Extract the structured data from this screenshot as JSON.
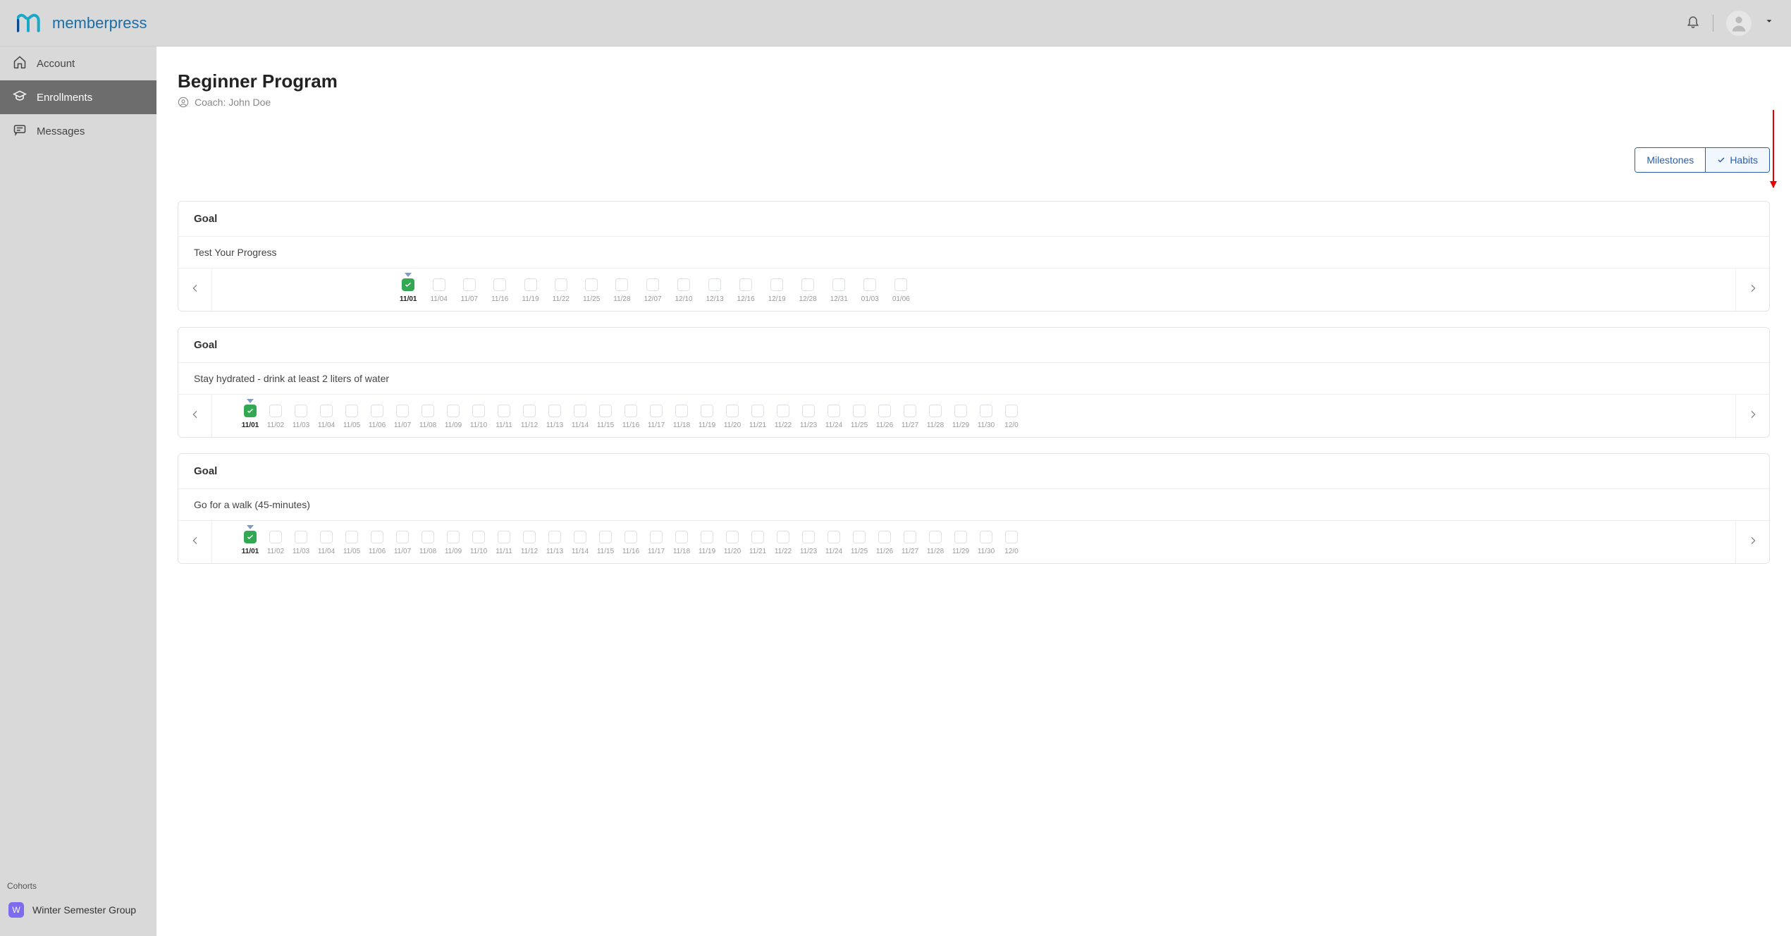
{
  "brand": "memberpress",
  "sidebar": {
    "items": [
      {
        "label": "Account",
        "active": false,
        "icon": "home-icon"
      },
      {
        "label": "Enrollments",
        "active": true,
        "icon": "mortarboard-icon"
      },
      {
        "label": "Messages",
        "active": false,
        "icon": "chat-icon"
      }
    ]
  },
  "cohorts": {
    "title": "Cohorts",
    "items": [
      {
        "badge": "W",
        "label": "Winter Semester Group"
      }
    ]
  },
  "page": {
    "title": "Beginner Program",
    "coach_prefix": "Coach:",
    "coach_name": "John Doe"
  },
  "tabs": {
    "milestones": "Milestones",
    "habits": "Habits",
    "active": "habits"
  },
  "goals": [
    {
      "header": "Goal",
      "subtitle": "Test Your Progress",
      "dense": false,
      "dates": [
        "11/01",
        "11/04",
        "11/07",
        "11/16",
        "11/19",
        "11/22",
        "11/25",
        "11/28",
        "12/07",
        "12/10",
        "12/13",
        "12/16",
        "12/19",
        "12/28",
        "12/31",
        "01/03",
        "01/06"
      ],
      "checked_index": 0,
      "marker_index": 0
    },
    {
      "header": "Goal",
      "subtitle": "Stay hydrated - drink at least 2 liters of water",
      "dense": true,
      "dates": [
        "11/01",
        "11/02",
        "11/03",
        "11/04",
        "11/05",
        "11/06",
        "11/07",
        "11/08",
        "11/09",
        "11/10",
        "11/11",
        "11/12",
        "11/13",
        "11/14",
        "11/15",
        "11/16",
        "11/17",
        "11/18",
        "11/19",
        "11/20",
        "11/21",
        "11/22",
        "11/23",
        "11/24",
        "11/25",
        "11/26",
        "11/27",
        "11/28",
        "11/29",
        "11/30",
        "12/0"
      ],
      "checked_index": 0,
      "marker_index": 0
    },
    {
      "header": "Goal",
      "subtitle": "Go for a walk (45-minutes)",
      "dense": true,
      "dates": [
        "11/01",
        "11/02",
        "11/03",
        "11/04",
        "11/05",
        "11/06",
        "11/07",
        "11/08",
        "11/09",
        "11/10",
        "11/11",
        "11/12",
        "11/13",
        "11/14",
        "11/15",
        "11/16",
        "11/17",
        "11/18",
        "11/19",
        "11/20",
        "11/21",
        "11/22",
        "11/23",
        "11/24",
        "11/25",
        "11/26",
        "11/27",
        "11/28",
        "11/29",
        "11/30",
        "12/0"
      ],
      "checked_index": 0,
      "marker_index": 0
    }
  ]
}
